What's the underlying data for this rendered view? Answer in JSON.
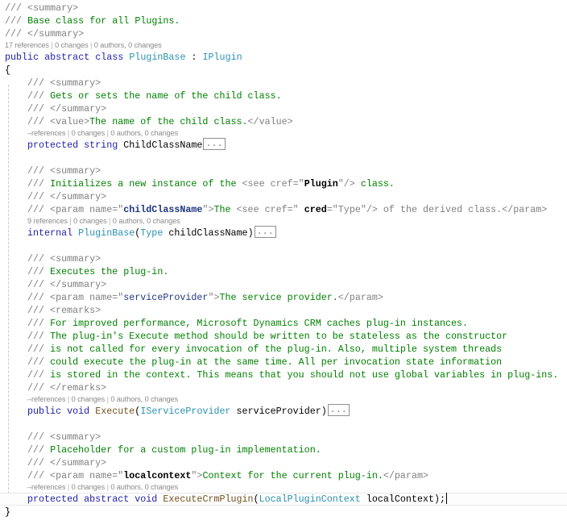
{
  "class_block": {
    "doc": {
      "open": "/// <summary>",
      "text_prefix": "/// ",
      "text": "Base class for all Plugins.",
      "close": "/// </summary>"
    },
    "codelens": {
      "references": "17 references",
      "changes": "0 changes",
      "authors": "0 authors, 0 changes"
    },
    "decl": {
      "kw1": "public",
      "kw2": "abstract",
      "kw3": "class",
      "name": "PluginBase",
      "colon": " : ",
      "base": "IPlugin"
    },
    "open_brace": "{",
    "close_brace": "}"
  },
  "members": [
    {
      "doc_open": "/// <summary>",
      "doc_text": "Gets or sets the name of the child class.",
      "doc_close": "/// </summary>",
      "value_open": "/// <value>",
      "value_text": "The name of the child class.",
      "value_close": "</value>",
      "codelens": {
        "references": "–references",
        "changes": "0 changes",
        "authors": "0 authors, 0 changes"
      },
      "decl": {
        "kw1": "protected",
        "kw2": "string",
        "name": "ChildClassName"
      },
      "collapsed": "..."
    },
    {
      "doc_open": "/// <summary>",
      "doc_text": "Initializes a new instance of the ",
      "see_open": "<see cref=\"",
      "see_ref": "Plugin",
      "see_close": "\"/>",
      "doc_text_end": " class.",
      "doc_close": "/// </summary>",
      "param_open": "/// <param name=\"",
      "param_name": "childClassName",
      "param_mid": "\">",
      "param_text": "The ",
      "param_see": "<see cref=\" ",
      "param_cred": "cred",
      "param_cred_eq": "=\"Type\"/> of the derived class.</param>",
      "codelens": {
        "references": "9 references",
        "changes": "0 changes",
        "authors": "0 authors, 0 changes"
      },
      "decl": {
        "kw1": "internal",
        "name": "PluginBase",
        "paren_open": "(",
        "type": "Type",
        "arg": " childClassName",
        "paren_close": ")"
      },
      "collapsed": "..."
    },
    {
      "doc_open": "/// <summary>",
      "doc_text": "Executes the plug-in.",
      "doc_close": "/// </summary>",
      "param_open": "/// <param name=\"",
      "param_name": "serviceProvider",
      "param_mid": "\">",
      "param_text": "The service provider.",
      "param_close": "</param>",
      "remarks_open": "/// <remarks>",
      "remarks": [
        "For improved performance, Microsoft Dynamics CRM caches plug-in instances.",
        "The plug-in's Execute method should be written to be stateless as the constructor",
        "is not called for every invocation of the plug-in. Also, multiple system threads",
        "could execute the plug-in at the same time. All per invocation state information",
        "is stored in the context. This means that you should not use global variables in plug-ins."
      ],
      "remarks_close": "/// </remarks>",
      "codelens": {
        "references": "–references",
        "changes": "0 changes",
        "authors": "0 authors, 0 changes"
      },
      "decl": {
        "kw1": "public",
        "kw2": "void",
        "name": "Execute",
        "paren_open": "(",
        "type": "IServiceProvider",
        "arg": " serviceProvider",
        "paren_close": ")"
      },
      "collapsed": "..."
    },
    {
      "doc_open": "/// <summary>",
      "doc_text": "Placeholder for a custom plug-in implementation.",
      "doc_close": "/// </summary>",
      "param_open": "/// <param name=\"",
      "param_name": "localcontext",
      "param_mid": "\">",
      "param_text": "Context for the current plug-in.",
      "param_close": "</param>",
      "codelens": {
        "references": "–references",
        "changes": "0 changes",
        "authors": "0 authors, 0 changes"
      },
      "decl": {
        "kw1": "protected",
        "kw2": "abstract",
        "kw3": "void",
        "name": "ExecuteCrmPlugin",
        "paren_open": "(",
        "type": "LocalPluginContext",
        "arg": " localContext",
        "paren_close": ");"
      }
    }
  ],
  "codelens_separator": " | "
}
